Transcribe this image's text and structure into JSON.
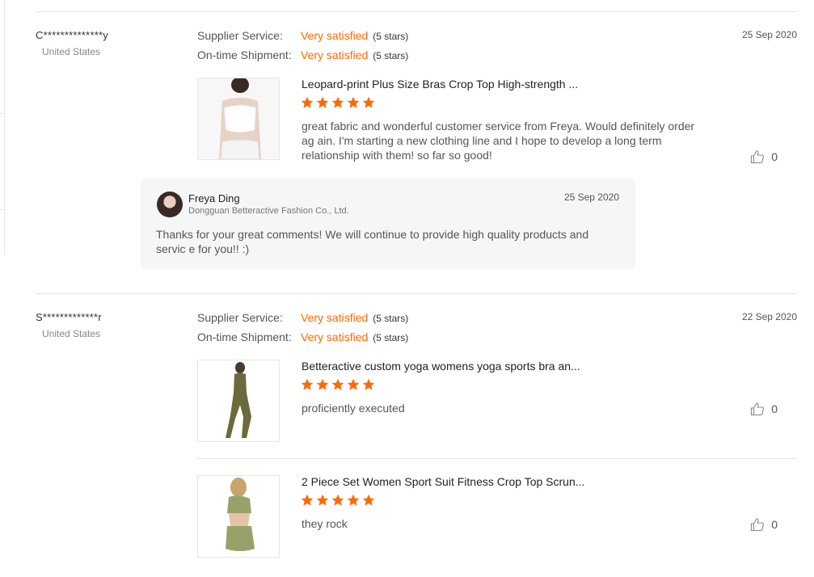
{
  "reviews": [
    {
      "buyer": "C**************y",
      "country": "United States",
      "supplier_label": "Supplier Service:",
      "supplier_value": "Very satisfied",
      "supplier_stars": "(5 stars)",
      "shipment_label": "On-time Shipment:",
      "shipment_value": "Very satisfied",
      "shipment_stars": "(5 stars)",
      "date": "25 Sep 2020",
      "products": [
        {
          "title": "Leopard-print Plus Size Bras Crop Top High-strength ...",
          "rating": 5,
          "comment": "great fabric and wonderful customer service from Freya. Would definitely order ag ain. I'm starting a new clothing line and I hope to develop a long term relationship with them! so far so good!",
          "likes": "0"
        }
      ],
      "reply": {
        "name": "Freya Ding",
        "company": "Dongguan Betteractive Fashion Co., Ltd.",
        "date": "25 Sep 2020",
        "text": "Thanks for your great comments! We will continue to provide high quality products and servic e for you!! :)"
      }
    },
    {
      "buyer": "S*************r",
      "country": "United States",
      "supplier_label": "Supplier Service:",
      "supplier_value": "Very satisfied",
      "supplier_stars": "(5 stars)",
      "shipment_label": "On-time Shipment:",
      "shipment_value": "Very satisfied",
      "shipment_stars": "(5 stars)",
      "date": "22 Sep 2020",
      "products": [
        {
          "title": "Betteractive custom yoga womens yoga sports bra an...",
          "rating": 5,
          "comment": "proficiently executed",
          "likes": "0"
        },
        {
          "title": "2 Piece Set Women Sport Suit Fitness Crop Top Scrun...",
          "rating": 5,
          "comment": "they rock",
          "likes": "0"
        }
      ]
    }
  ],
  "colors": {
    "accent": "#ff6a00",
    "divider": "#e2e2e2",
    "reply_bg": "#f5f6f8"
  },
  "icons": {
    "star": "star-icon",
    "like": "thumbs-up-icon"
  }
}
